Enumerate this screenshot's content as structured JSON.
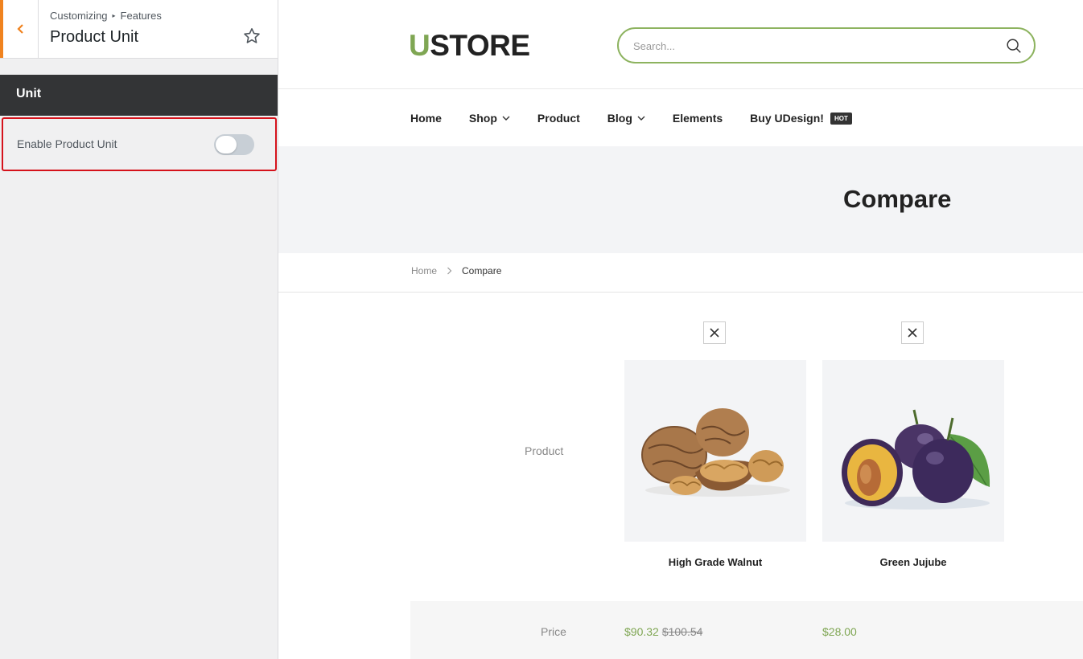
{
  "sidebar": {
    "breadcrumb_root": "Customizing",
    "breadcrumb_section": "Features",
    "title": "Product Unit",
    "section_heading": "Unit",
    "control_label": "Enable Product Unit",
    "toggle_enabled": false,
    "accent_color": "#f0831f"
  },
  "store": {
    "logo_first": "U",
    "logo_rest": "STORE",
    "search_placeholder": "Search...",
    "nav": {
      "home": "Home",
      "shop": "Shop",
      "product": "Product",
      "blog": "Blog",
      "elements": "Elements",
      "buy": "Buy UDesign!",
      "hot_badge": "HOT"
    },
    "page_title": "Compare",
    "breadcrumb": {
      "home": "Home",
      "current": "Compare"
    },
    "compare": {
      "row_product_label": "Product",
      "row_price_label": "Price",
      "products": [
        {
          "name": "High Grade Walnut",
          "price": "$90.32",
          "old_price": "$100.54"
        },
        {
          "name": "Green Jujube",
          "price": "$28.00",
          "old_price": ""
        }
      ]
    },
    "brand_color": "#7fa653"
  }
}
